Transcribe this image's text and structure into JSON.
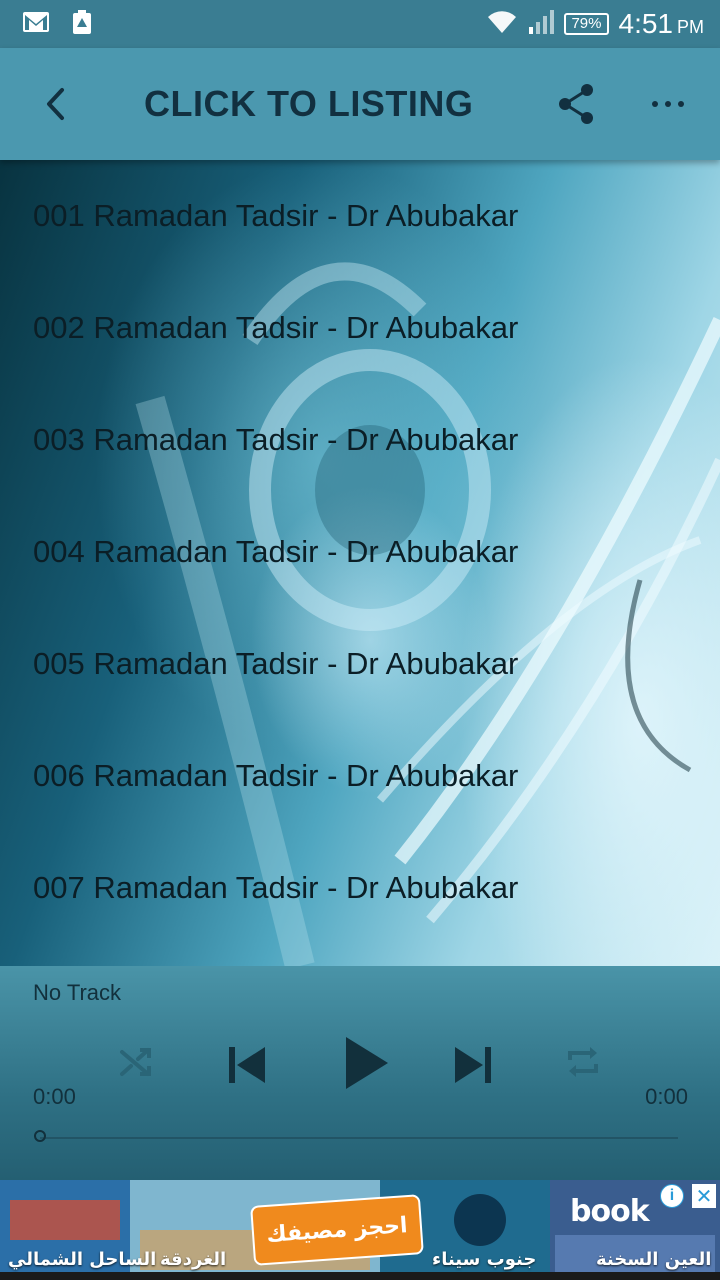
{
  "status_bar": {
    "battery": "79%",
    "time": "4:51",
    "ampm": "PM"
  },
  "app_bar": {
    "title": "CLICK TO LISTING"
  },
  "tracks": [
    {
      "label": "001 Ramadan Tadsir - Dr Abubakar"
    },
    {
      "label": "002 Ramadan Tadsir - Dr Abubakar"
    },
    {
      "label": "003 Ramadan Tadsir - Dr Abubakar"
    },
    {
      "label": "004 Ramadan Tadsir - Dr Abubakar"
    },
    {
      "label": "005 Ramadan Tadsir - Dr Abubakar"
    },
    {
      "label": "006 Ramadan Tadsir - Dr Abubakar"
    },
    {
      "label": "007 Ramadan Tadsir - Dr Abubakar"
    }
  ],
  "player": {
    "now_playing": "No Track",
    "current_time": "0:00",
    "total_time": "0:00",
    "progress": 0
  },
  "ad": {
    "cta": "احجز مصيفك",
    "brand": "book",
    "labels": [
      "الساحل الشمالي",
      "الغردقة",
      "جنوب سيناء",
      "العين السخنة"
    ]
  },
  "colors": {
    "app_bar": "#4b98af",
    "status_bar": "#3a7d92",
    "player": "#2f7185",
    "text_dark": "#0b1e26"
  }
}
